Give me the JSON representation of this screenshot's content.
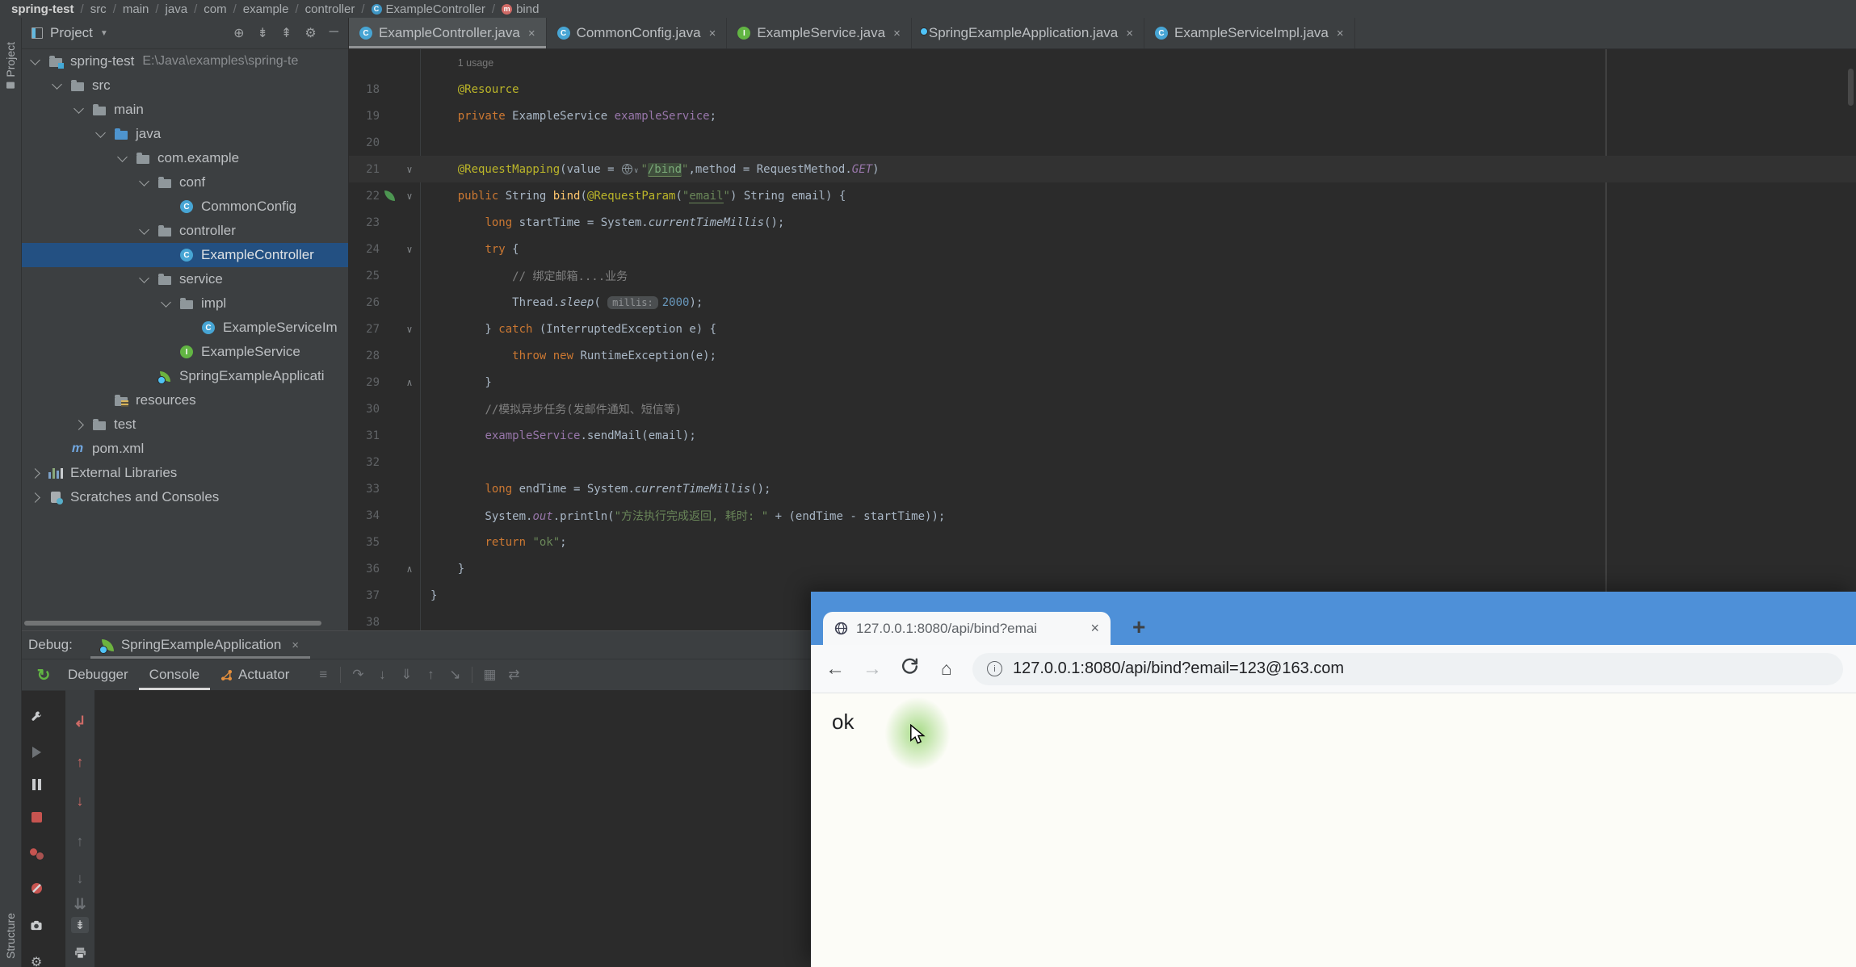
{
  "breadcrumb": {
    "separator": "/",
    "items": [
      {
        "label": "spring-test",
        "bold": true
      },
      {
        "label": "src"
      },
      {
        "label": "main"
      },
      {
        "label": "java"
      },
      {
        "label": "com"
      },
      {
        "label": "example"
      },
      {
        "label": "controller"
      },
      {
        "label": "ExampleController",
        "icon": "class"
      },
      {
        "label": "bind",
        "icon": "method"
      }
    ]
  },
  "tool_stripes": {
    "project": "Project",
    "structure": "Structure"
  },
  "glyphs": {
    "close": "×",
    "new_tab": "+",
    "dropdown": "▾",
    "fold_down": "∨",
    "fold_up": "∧"
  },
  "project_panel": {
    "title": "Project",
    "header_icons": [
      "locate",
      "collapse-all",
      "expand-all",
      "settings",
      "hide"
    ],
    "tree": [
      {
        "indent": 0,
        "arrow": "open",
        "icon": "folder-project",
        "label": "spring-test",
        "path": "E:\\Java\\examples\\spring-te"
      },
      {
        "indent": 1,
        "arrow": "open",
        "icon": "folder",
        "label": "src"
      },
      {
        "indent": 2,
        "arrow": "open",
        "icon": "folder",
        "label": "main"
      },
      {
        "indent": 3,
        "arrow": "open",
        "icon": "folder-src",
        "label": "java"
      },
      {
        "indent": 4,
        "arrow": "open",
        "icon": "package",
        "label": "com.example"
      },
      {
        "indent": 5,
        "arrow": "open",
        "icon": "package",
        "label": "conf"
      },
      {
        "indent": 6,
        "arrow": "none",
        "icon": "class",
        "label": "CommonConfig"
      },
      {
        "indent": 5,
        "arrow": "open",
        "icon": "package",
        "label": "controller"
      },
      {
        "indent": 6,
        "arrow": "none",
        "icon": "class",
        "label": "ExampleController",
        "selected": true
      },
      {
        "indent": 5,
        "arrow": "open",
        "icon": "package",
        "label": "service"
      },
      {
        "indent": 6,
        "arrow": "open",
        "icon": "package",
        "label": "impl"
      },
      {
        "indent": 7,
        "arrow": "none",
        "icon": "class",
        "label": "ExampleServiceIm"
      },
      {
        "indent": 6,
        "arrow": "none",
        "icon": "interface",
        "label": "ExampleService"
      },
      {
        "indent": 5,
        "arrow": "none",
        "icon": "spring-boot",
        "label": "SpringExampleApplicati"
      },
      {
        "indent": 3,
        "arrow": "none",
        "icon": "folder-resources",
        "label": "resources"
      },
      {
        "indent": 2,
        "arrow": "closed",
        "icon": "folder",
        "label": "test"
      },
      {
        "indent": 1,
        "arrow": "none",
        "icon": "maven",
        "label": "pom.xml"
      },
      {
        "indent": 0,
        "arrow": "closed",
        "icon": "libraries",
        "label": "External Libraries"
      },
      {
        "indent": 0,
        "arrow": "closed",
        "icon": "scratches",
        "label": "Scratches and Consoles"
      }
    ]
  },
  "editor_tabs": [
    {
      "icon": "class",
      "label": "ExampleController.java",
      "selected": true
    },
    {
      "icon": "class",
      "label": "CommonConfig.java"
    },
    {
      "icon": "interface",
      "label": "ExampleService.java"
    },
    {
      "icon": "spring-boot",
      "label": "SpringExampleApplication.java"
    },
    {
      "icon": "class",
      "label": "ExampleServiceImpl.java"
    }
  ],
  "editor": {
    "lines": [
      {
        "no": "",
        "tokens": [
          [
            "    ",
            "def"
          ],
          [
            "1 usage",
            "usage"
          ]
        ]
      },
      {
        "no": "18",
        "tokens": [
          [
            "    ",
            "def"
          ],
          [
            "@Resource",
            "ann"
          ]
        ]
      },
      {
        "no": "19",
        "tokens": [
          [
            "    ",
            "def"
          ],
          [
            "private ",
            "kw"
          ],
          [
            "ExampleService ",
            "def"
          ],
          [
            "exampleService",
            "fld"
          ],
          [
            ";",
            "def"
          ]
        ]
      },
      {
        "no": "20",
        "tokens": []
      },
      {
        "no": "21",
        "fold": "down",
        "active": true,
        "tokens": [
          [
            "    ",
            "def"
          ],
          [
            "@RequestMapping",
            "ann"
          ],
          [
            "(value = ",
            "def"
          ],
          [
            "",
            "globe"
          ],
          [
            "\"",
            "str"
          ],
          [
            "/bind",
            "strbox"
          ],
          [
            "\"",
            "str"
          ],
          [
            ",method = RequestMethod.",
            "def"
          ],
          [
            "GET",
            "stat"
          ],
          [
            ")",
            "def"
          ]
        ]
      },
      {
        "no": "22",
        "fold": "down",
        "gutter": "spring-mapping",
        "tokens": [
          [
            "    ",
            "def"
          ],
          [
            "public ",
            "kw"
          ],
          [
            "String ",
            "def"
          ],
          [
            "bind",
            "mth"
          ],
          [
            "(",
            "def"
          ],
          [
            "@RequestParam",
            "ann"
          ],
          [
            "(",
            "def"
          ],
          [
            "\"",
            "str"
          ],
          [
            "email",
            "stru"
          ],
          [
            "\"",
            "str"
          ],
          [
            ") ",
            "def"
          ],
          [
            "String email) {",
            "def"
          ]
        ]
      },
      {
        "no": "23",
        "tokens": [
          [
            "        ",
            "def"
          ],
          [
            "long ",
            "kw"
          ],
          [
            "startTime = System.",
            "def"
          ],
          [
            "currentTimeMillis",
            "it"
          ],
          [
            "();",
            "def"
          ]
        ]
      },
      {
        "no": "24",
        "fold": "down",
        "tokens": [
          [
            "        ",
            "def"
          ],
          [
            "try",
            "kw"
          ],
          [
            " {",
            "def"
          ]
        ]
      },
      {
        "no": "25",
        "tokens": [
          [
            "            ",
            "def"
          ],
          [
            "// 绑定邮箱....业务",
            "cmt"
          ]
        ]
      },
      {
        "no": "26",
        "tokens": [
          [
            "            Thread.",
            "def"
          ],
          [
            "sleep",
            "it"
          ],
          [
            "( ",
            "def"
          ],
          [
            "millis:",
            "hint"
          ],
          [
            "2000",
            "num"
          ],
          [
            ");",
            "def"
          ]
        ]
      },
      {
        "no": "27",
        "fold": "down",
        "tokens": [
          [
            "        } ",
            "def"
          ],
          [
            "catch",
            "kw"
          ],
          [
            " (InterruptedException e) {",
            "def"
          ]
        ]
      },
      {
        "no": "28",
        "tokens": [
          [
            "            ",
            "def"
          ],
          [
            "throw new ",
            "kw"
          ],
          [
            "RuntimeException(e);",
            "def"
          ]
        ]
      },
      {
        "no": "29",
        "fold": "up",
        "tokens": [
          [
            "        }",
            "def"
          ]
        ]
      },
      {
        "no": "30",
        "tokens": [
          [
            "        ",
            "def"
          ],
          [
            "//模拟异步任务(发邮件通知、短信等)",
            "cmt"
          ]
        ]
      },
      {
        "no": "31",
        "tokens": [
          [
            "        ",
            "def"
          ],
          [
            "exampleService",
            "fld"
          ],
          [
            ".sendMail(email);",
            "def"
          ]
        ]
      },
      {
        "no": "32",
        "tokens": []
      },
      {
        "no": "33",
        "tokens": [
          [
            "        ",
            "def"
          ],
          [
            "long ",
            "kw"
          ],
          [
            "endTime = System.",
            "def"
          ],
          [
            "currentTimeMillis",
            "it"
          ],
          [
            "();",
            "def"
          ]
        ]
      },
      {
        "no": "34",
        "tokens": [
          [
            "        System.",
            "def"
          ],
          [
            "out",
            "stat"
          ],
          [
            ".println(",
            "def"
          ],
          [
            "\"方法执行完成返回, 耗时: \"",
            "str"
          ],
          [
            " + (endTime - startTime));",
            "def"
          ]
        ]
      },
      {
        "no": "35",
        "tokens": [
          [
            "        ",
            "def"
          ],
          [
            "return ",
            "kw"
          ],
          [
            "\"ok\"",
            "str"
          ],
          [
            ";",
            "def"
          ]
        ]
      },
      {
        "no": "36",
        "fold": "up",
        "tokens": [
          [
            "    }",
            "def"
          ]
        ]
      },
      {
        "no": "37",
        "tokens": [
          [
            "}",
            "def"
          ]
        ]
      },
      {
        "no": "38",
        "tokens": []
      }
    ]
  },
  "debug_panel": {
    "label": "Debug:",
    "session_name": "SpringExampleApplication",
    "tabs": [
      {
        "label": "Debugger"
      },
      {
        "label": "Console",
        "selected": true
      },
      {
        "label": "Actuator",
        "icon": "actuator"
      }
    ],
    "toolbar_icons": [
      "layout",
      "divider",
      "step-over",
      "step-into",
      "force-step-into",
      "step-out",
      "run-to-cursor",
      "divider",
      "evaluate",
      "more"
    ],
    "left_column_icons": [
      "settings-wrench",
      "resume",
      "pause",
      "stop",
      "view-breakpoints",
      "mute-breakpoints",
      "thread-dump-camera",
      "gear"
    ],
    "right_column_icons": [
      "show-execution-point",
      "frame-up",
      "frame-down",
      "stack-up",
      "stack-down",
      "double-down",
      "scroll-to-end",
      "print"
    ]
  },
  "browser": {
    "tab_title": "127.0.0.1:8080/api/bind?emai",
    "url": "127.0.0.1:8080/api/bind?email=123@163.com",
    "body_text": "ok"
  },
  "colors": {
    "titlebar_blue": "#4e90d8",
    "selection_blue": "#235082",
    "spring_green": "#6db33f",
    "click_highlight_green": "#8ed166",
    "stop_red": "#c75450"
  }
}
